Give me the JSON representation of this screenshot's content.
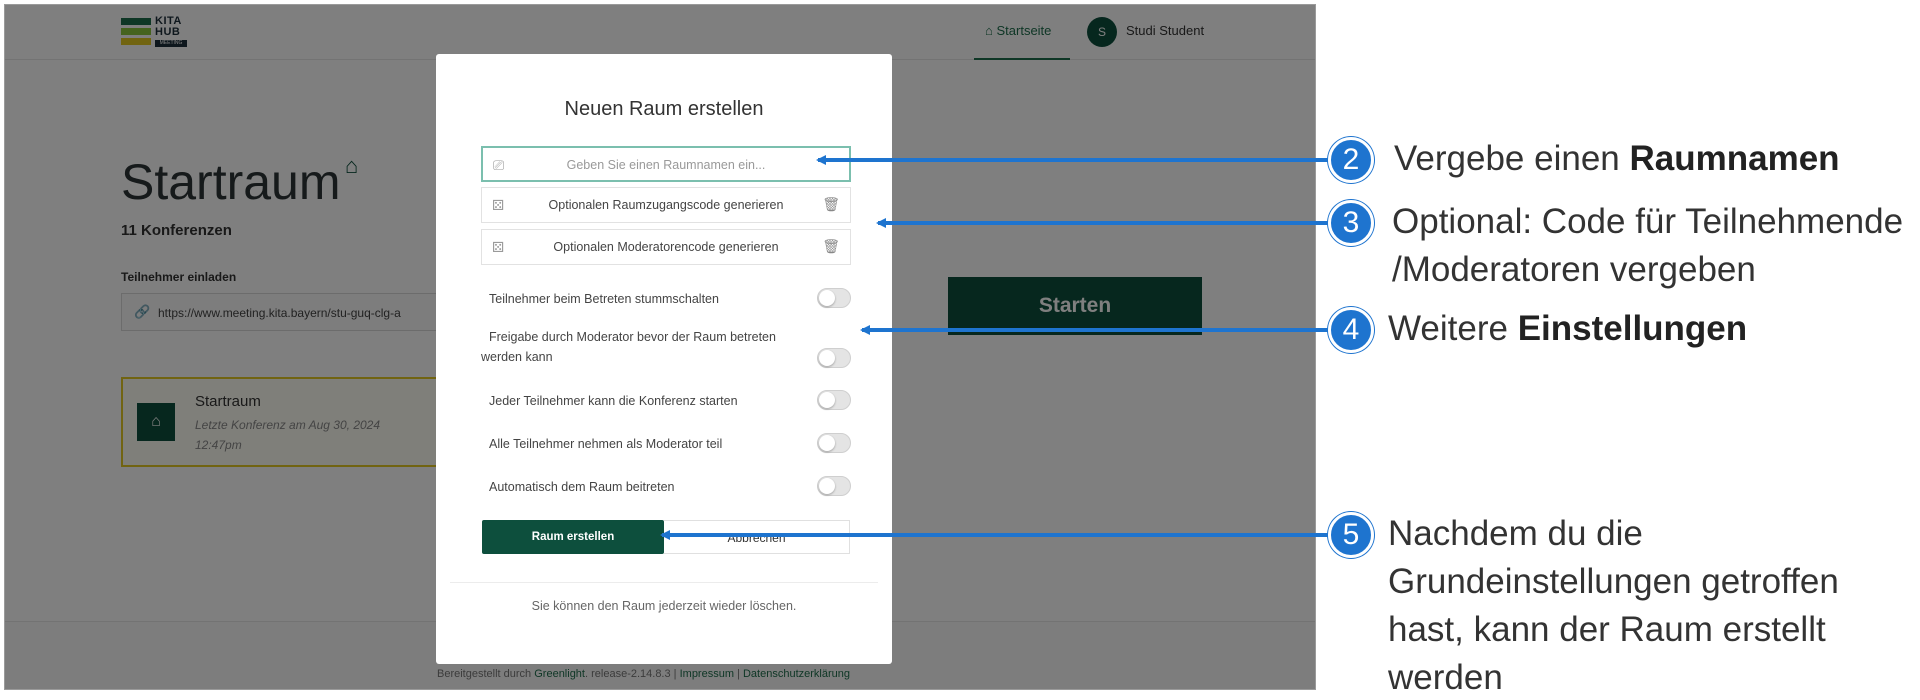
{
  "app": {
    "logo_line1": "KITA",
    "logo_line2": "HUB",
    "logo_tag": "MEETING",
    "nav_home": "Startseite",
    "user_initial": "S",
    "user_name": "Studi Student"
  },
  "room": {
    "title": "Startraum",
    "conferences": "11 Konferenzen",
    "invite_label": "Teilnehmer einladen",
    "invite_url": "https://www.meeting.kita.bayern/stu-guq-clg-a",
    "start_button": "Starten",
    "card_name": "Startraum",
    "card_date": "Letzte Konferenz am Aug 30, 2024 12:47pm"
  },
  "footer": {
    "prefix": "Bereitgestellt durch",
    "greenlight": "Greenlight",
    "release": ". release-2.14.8.3 |",
    "impressum": "Impressum",
    "sep": "|",
    "privacy": "Datenschutzerklärung"
  },
  "modal": {
    "title": "Neuen Raum erstellen",
    "name_placeholder": "Geben Sie einen Raumnamen ein...",
    "access_code": "Optionalen Raumzugangscode generieren",
    "moderator_code": "Optionalen Moderatorencode generieren",
    "toggles": [
      "Teilnehmer beim Betreten stummschalten",
      "Freigabe durch Moderator bevor der Raum betreten werden kann",
      "Jeder Teilnehmer kann die Konferenz starten",
      "Alle Teilnehmer nehmen als Moderator teil",
      "Automatisch dem Raum beitreten"
    ],
    "create_button": "Raum erstellen",
    "cancel_button": "Abbrechen",
    "footer_note": "Sie können den Raum jederzeit wieder löschen."
  },
  "callouts": [
    {
      "number": "2",
      "text": "Vergebe einen ",
      "bold": "Raumnamen"
    },
    {
      "number": "3",
      "line1": "Optional: Code für Teilnehmende",
      "line2": "/Moderatoren vergeben"
    },
    {
      "number": "4",
      "text": "Weitere ",
      "bold": "Einstellungen"
    },
    {
      "number": "5",
      "lines": [
        "Nachdem du die",
        "Grundeinstellungen getroffen",
        "hast, kann der Raum erstellt",
        "werden"
      ]
    }
  ],
  "colors": {
    "brand_green": "#0d4f3d",
    "callout_blue": "#1e74cf",
    "logo_yellow": "#e3c923"
  }
}
